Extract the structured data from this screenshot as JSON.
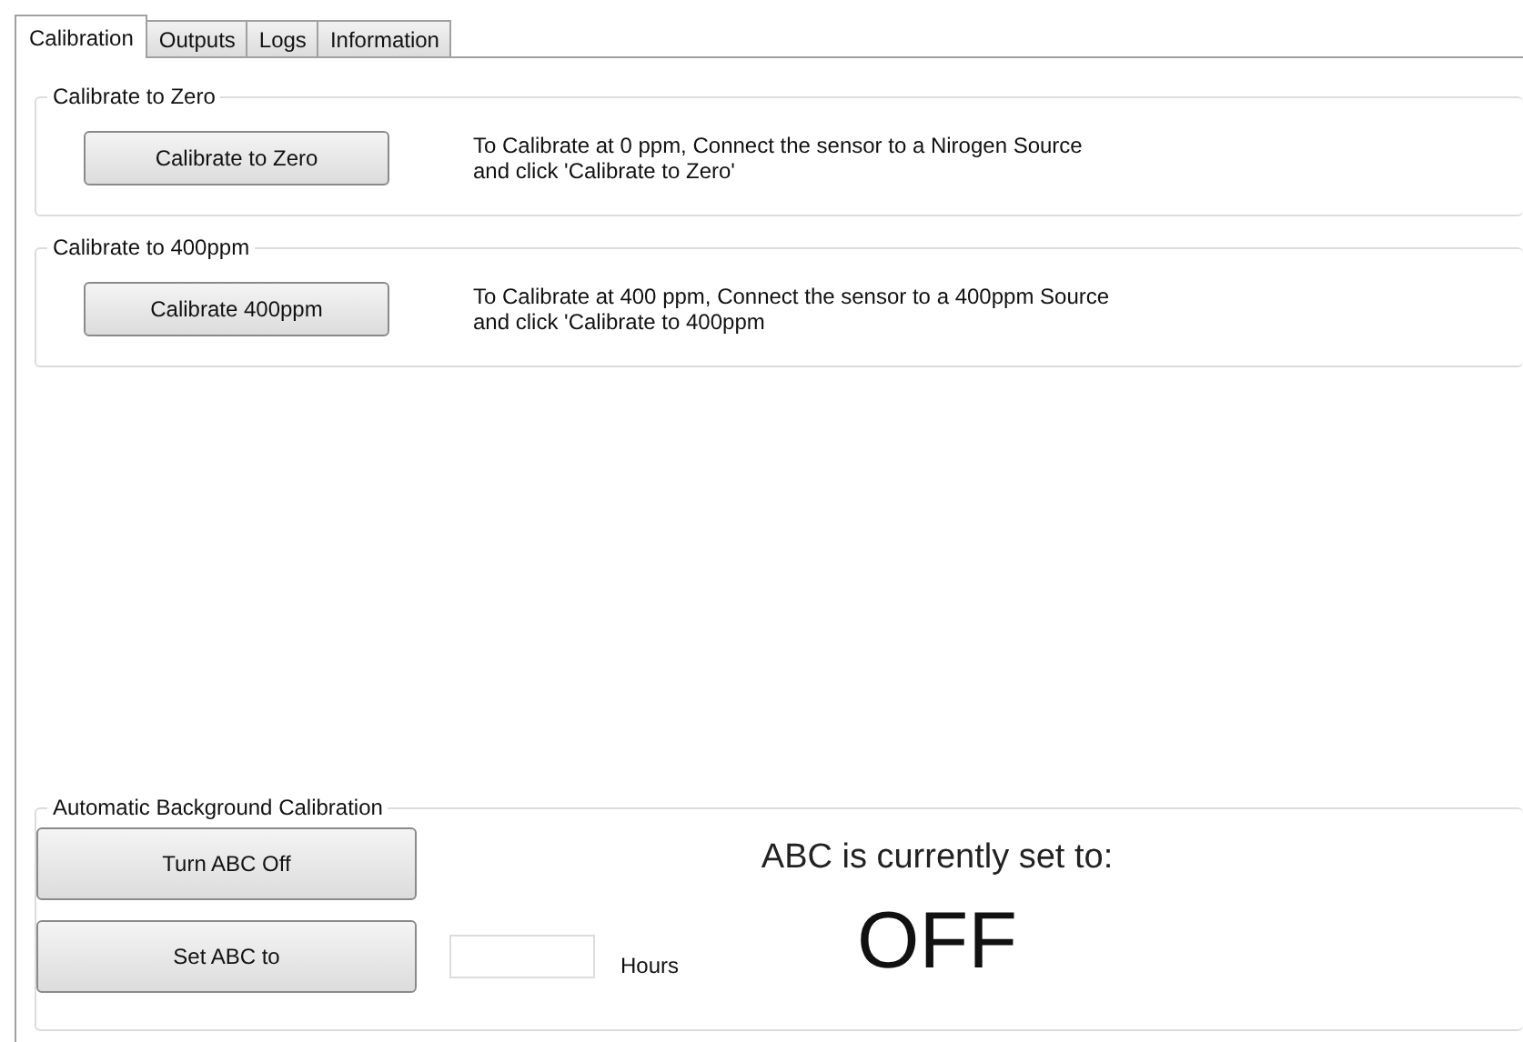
{
  "tabs": [
    {
      "label": "Calibration",
      "selected": true
    },
    {
      "label": "Outputs",
      "selected": false
    },
    {
      "label": "Logs",
      "selected": false
    },
    {
      "label": "Information",
      "selected": false
    }
  ],
  "groups": [
    {
      "title": "Calibrate to Zero",
      "button": "Calibrate to Zero",
      "instructions": [
        "To Calibrate at 0 ppm, Connect the sensor to a Nirogen Source",
        "and click 'Calibrate to Zero'"
      ]
    },
    {
      "title": "Calibrate to 400ppm",
      "button": "Calibrate 400ppm",
      "instructions": [
        "To Calibrate at 400 ppm, Connect the sensor to a 400ppm Source",
        "and click 'Calibrate to 400ppm"
      ]
    }
  ],
  "abc": {
    "title": "Automatic Background Calibration",
    "off_button": "Turn ABC Off",
    "set_button": "Set ABC to",
    "hours_unit": "Hours",
    "status_label": "ABC is currently set to:",
    "status_value": "OFF"
  }
}
